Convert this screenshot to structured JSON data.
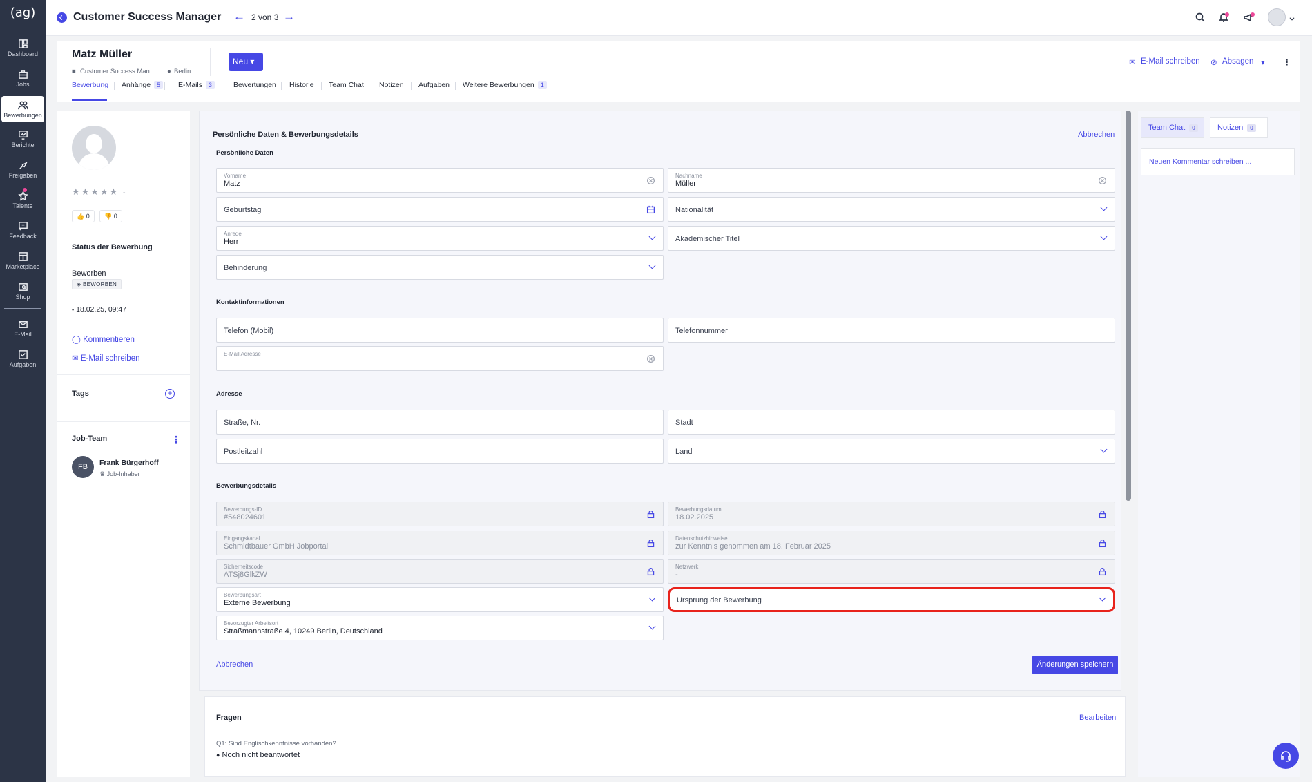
{
  "app": {
    "logo": "(ag)"
  },
  "sidebar": {
    "items": [
      {
        "label": "Dashboard",
        "icon": "dashboard-icon"
      },
      {
        "label": "Jobs",
        "icon": "briefcase-icon"
      },
      {
        "label": "Bewerbungen",
        "icon": "users-icon"
      },
      {
        "label": "Berichte",
        "icon": "chart-icon"
      },
      {
        "label": "Freigaben",
        "icon": "share-icon"
      },
      {
        "label": "Talente",
        "icon": "star-icon"
      },
      {
        "label": "Feedback",
        "icon": "feedback-icon"
      },
      {
        "label": "Marketplace",
        "icon": "marketplace-icon"
      },
      {
        "label": "Shop",
        "icon": "shop-icon"
      },
      {
        "label": "E-Mail",
        "icon": "mail-icon"
      },
      {
        "label": "Aufgaben",
        "icon": "tasks-icon"
      }
    ]
  },
  "topbar": {
    "title": "Customer Success Manager",
    "pager": "2 von 3",
    "prev": "←",
    "next": "→"
  },
  "candidate": {
    "name": "Matz Müller",
    "job": "Customer Success Man...",
    "location": "Berlin",
    "new_button": "Neu",
    "email_link": "E-Mail schreiben",
    "reject_link": "Absagen",
    "tabs": [
      {
        "label": "Bewerbung",
        "count": ""
      },
      {
        "label": "Anhänge",
        "count": "5"
      },
      {
        "label": "E-Mails",
        "count": "3"
      },
      {
        "label": "Bewertungen",
        "count": ""
      },
      {
        "label": "Historie",
        "count": ""
      },
      {
        "label": "Team Chat",
        "count": ""
      },
      {
        "label": "Notizen",
        "count": ""
      },
      {
        "label": "Aufgaben",
        "count": ""
      },
      {
        "label": "Weitere Bewerbungen",
        "count": "1"
      }
    ]
  },
  "profile": {
    "stars": "★★★★★",
    "rating_dash": "-",
    "likes": "0",
    "dislikes": "0",
    "status_heading": "Status der Bewerbung",
    "status": "Beworben",
    "status_badge": "BEWORBEN",
    "date": "18.02.25, 09:47",
    "comment_link": "Kommentieren",
    "email_link": "E-Mail schreiben",
    "tags_heading": "Tags",
    "tags_add": "+",
    "team_heading": "Job-Team",
    "member_initials": "FB",
    "member_name": "Frank Bürgerhoff",
    "member_role": "Job-Inhaber"
  },
  "form": {
    "title": "Persönliche Daten & Bewerbungsdetails",
    "cancel_top": "Abbrechen",
    "sections": {
      "personal": "Persönliche Daten",
      "contact": "Kontaktinformationen",
      "address": "Adresse",
      "details": "Bewerbungsdetails"
    },
    "fields": {
      "vorname": {
        "label": "Vorname",
        "value": "Matz"
      },
      "nachname": {
        "label": "Nachname",
        "value": "Müller"
      },
      "geburtstag": {
        "placeholder": "Geburtstag"
      },
      "nationalitaet": {
        "placeholder": "Nationalität"
      },
      "anrede": {
        "label": "Anrede",
        "value": "Herr"
      },
      "titel": {
        "placeholder": "Akademischer Titel"
      },
      "behinderung": {
        "placeholder": "Behinderung"
      },
      "telefon_mobil": {
        "placeholder": "Telefon (Mobil)"
      },
      "telefon": {
        "placeholder": "Telefonnummer"
      },
      "email": {
        "label": "E-Mail Adresse",
        "value": ""
      },
      "strasse": {
        "placeholder": "Straße, Nr."
      },
      "stadt": {
        "placeholder": "Stadt"
      },
      "plz": {
        "placeholder": "Postleitzahl"
      },
      "land": {
        "placeholder": "Land"
      },
      "bewerbungs_id": {
        "label": "Bewerbungs-ID",
        "value": "#548024601"
      },
      "bewerbungsdatum": {
        "label": "Bewerbungsdatum",
        "value": "18.02.2025"
      },
      "eingangskanal": {
        "label": "Eingangskanal",
        "value": "Schmidtbauer GmbH Jobportal"
      },
      "datenschutz": {
        "label": "Datenschutzhinweise",
        "value": "zur Kenntnis genommen am 18. Februar 2025"
      },
      "sicherheitscode": {
        "label": "Sicherheitscode",
        "value": "ATSj8GlkZW"
      },
      "netzwerk": {
        "label": "Netzwerk",
        "value": "-"
      },
      "bewerbungsart": {
        "label": "Bewerbungsart",
        "value": "Externe Bewerbung"
      },
      "ursprung": {
        "placeholder": "Ursprung der Bewerbung"
      },
      "arbeitsort": {
        "label": "Bevorzugter Arbeitsort",
        "value": "Straßmannstraße 4, 10249 Berlin, Deutschland"
      }
    },
    "cancel_bottom": "Abbrechen",
    "save": "Änderungen speichern",
    "highlight_color": "#e8231c"
  },
  "questions": {
    "title": "Fragen",
    "edit": "Bearbeiten",
    "q1": "Q1: Sind Englischkenntnisse vorhanden?",
    "a1": "Noch nicht beantwortet"
  },
  "right_panel": {
    "tabs": [
      {
        "label": "Team Chat",
        "count": "0"
      },
      {
        "label": "Notizen",
        "count": "0"
      }
    ],
    "comment_placeholder": "Neuen Kommentar schreiben ..."
  },
  "colors": {
    "accent": "#4648e5",
    "sidebar": "#2c3446"
  }
}
